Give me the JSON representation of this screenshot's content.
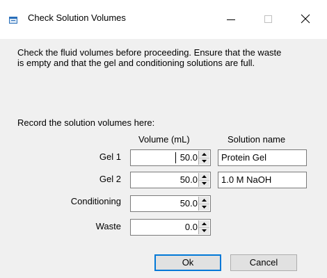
{
  "window": {
    "title": "Check Solution Volumes",
    "icons": {
      "app": "app-window-icon",
      "minimize": "minimize-icon",
      "maximize": "maximize-icon",
      "close": "close-icon"
    }
  },
  "instructions": "Check the fluid volumes before proceeding. Ensure that the waste is empty and that the gel and conditioning solutions are full.",
  "record_label": "Record the solution volumes here:",
  "columns": {
    "volume": "Volume (mL)",
    "solution": "Solution name"
  },
  "rows": [
    {
      "label": "Gel 1",
      "volume": "50.0",
      "solution": "Protein Gel"
    },
    {
      "label": "Gel 2",
      "volume": "50.0",
      "solution": "1.0 M NaOH"
    },
    {
      "label": "Conditioning",
      "volume": "50.0"
    },
    {
      "label": "Waste",
      "volume": "0.0"
    }
  ],
  "buttons": {
    "ok": "Ok",
    "cancel": "Cancel"
  },
  "colors": {
    "focus_border": "#0078d7",
    "client_bg": "#f0f0f0"
  }
}
